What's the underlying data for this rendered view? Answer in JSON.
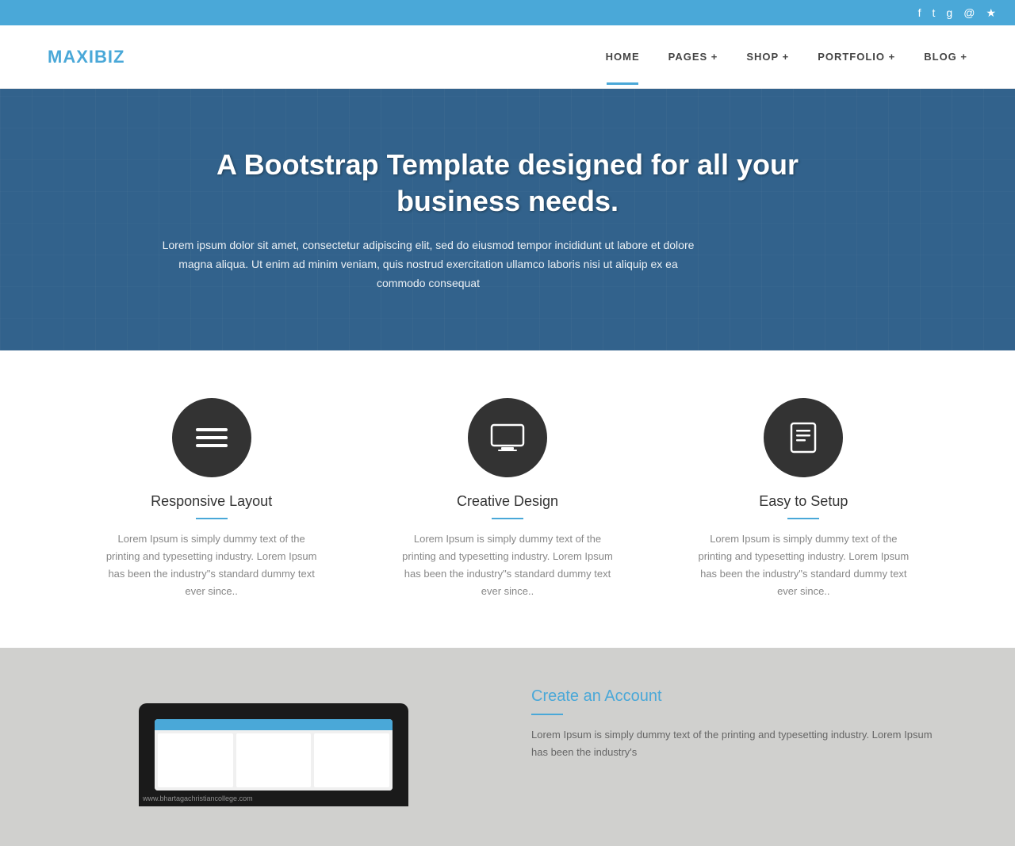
{
  "topbar": {
    "icons": [
      "facebook",
      "twitter",
      "google-plus",
      "dribbble",
      "rss"
    ]
  },
  "navbar": {
    "logo_maxi": "MAXI",
    "logo_biz": "BIZ",
    "nav_items": [
      {
        "label": "HOME",
        "active": true
      },
      {
        "label": "PAGES +",
        "active": false
      },
      {
        "label": "SHOP +",
        "active": false
      },
      {
        "label": "PORTFOLIO +",
        "active": false
      },
      {
        "label": "BLOG +",
        "active": false
      }
    ]
  },
  "hero": {
    "heading": "A Bootstrap Template designed for all your business needs.",
    "description": "Lorem ipsum dolor sit amet, consectetur adipiscing elit, sed do eiusmod tempor incididunt ut labore et dolore magna aliqua. Ut enim ad minim veniam, quis nostrud exercitation ullamco laboris nisi ut aliquip ex ea commodo consequat"
  },
  "features": {
    "items": [
      {
        "icon": "☰",
        "title": "Responsive Layout",
        "desc": "Lorem Ipsum is simply dummy text of the printing and typesetting industry. Lorem Ipsum has been the industry\"s standard dummy text ever since.."
      },
      {
        "icon": "💻",
        "title": "Creative Design",
        "desc": "Lorem Ipsum is simply dummy text of the printing and typesetting industry. Lorem Ipsum has been the industry\"s standard dummy text ever since.."
      },
      {
        "icon": "📖",
        "title": "Easy to Setup",
        "desc": "Lorem Ipsum is simply dummy text of the printing and typesetting industry. Lorem Ipsum has been the industry\"s standard dummy text ever since.."
      }
    ]
  },
  "bottom": {
    "title": "Create an Account",
    "desc": "Lorem Ipsum is simply dummy text of the printing and typesetting industry. Lorem Ipsum has been the industry's"
  },
  "watermark": "www.bhartagachristiancollege.com"
}
